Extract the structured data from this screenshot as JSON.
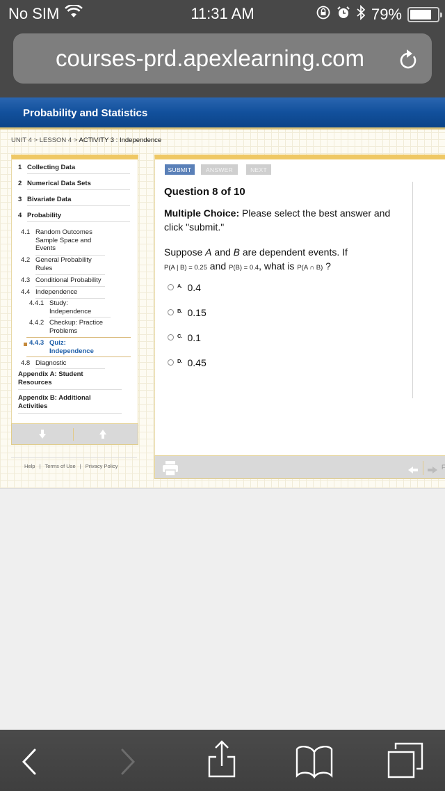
{
  "status_bar": {
    "carrier": "No SIM",
    "time": "11:31 AM",
    "battery_percent": "79%",
    "battery_level": 0.79
  },
  "browser": {
    "url": "courses-prd.apexlearning.com"
  },
  "header": {
    "course_title": "Probability and Statistics"
  },
  "breadcrumb": {
    "unit": "UNIT 4",
    "lesson": "LESSON 4",
    "sep": " > ",
    "activity": "ACTIVITY 3 : Independence"
  },
  "sidebar": {
    "items": [
      {
        "num": "1",
        "label": "Collecting Data"
      },
      {
        "num": "2",
        "label": "Numerical Data Sets"
      },
      {
        "num": "3",
        "label": "Bivariate Data"
      },
      {
        "num": "4",
        "label": "Probability"
      }
    ],
    "subitems": [
      {
        "num": "4.1",
        "label": "Random Outcomes Sample Space and Events"
      },
      {
        "num": "4.2",
        "label": "General Probability Rules"
      },
      {
        "num": "4.3",
        "label": "Conditional Probability"
      },
      {
        "num": "4.4",
        "label": "Independence"
      }
    ],
    "activities": [
      {
        "num": "4.4.1",
        "label": "Study: Independence"
      },
      {
        "num": "4.4.2",
        "label": "Checkup: Practice Problems"
      },
      {
        "num": "4.4.3",
        "label": "Quiz: Independence",
        "active": true
      }
    ],
    "diagnostic": {
      "num": "4.8",
      "label": "Diagnostic"
    },
    "appendices": [
      {
        "label": "Appendix A: Student Resources"
      },
      {
        "label": "Appendix B: Additional Activities"
      }
    ]
  },
  "footer": {
    "help": "Help",
    "terms": "Terms of Use",
    "privacy": "Privacy Policy",
    "sep": "|"
  },
  "quiz": {
    "buttons": {
      "submit": "SUBMIT",
      "answer": "ANSWER",
      "next": "NEXT"
    },
    "question_title": "Question 8 of 10",
    "instruction_label": "Multiple Choice:",
    "instruction_text": " Please select the best answer and click \"submit.\"",
    "question": {
      "part1": "Suppose ",
      "var_a": "A",
      "part2": " and ",
      "var_b": "B",
      "part3": " are dependent events. If",
      "expr1": "P(A | B) = 0.25",
      "and": " and ",
      "expr2": "P(B) = 0.4",
      "part4": ", what is ",
      "expr3": "P(A ∩ B)",
      "part5": " ?"
    },
    "options": [
      {
        "letter": "A.",
        "value": "0.4"
      },
      {
        "letter": "B.",
        "value": "0.15"
      },
      {
        "letter": "C.",
        "value": "0.1"
      },
      {
        "letter": "D.",
        "value": "0.45"
      }
    ],
    "footer_cut_text": "F"
  }
}
